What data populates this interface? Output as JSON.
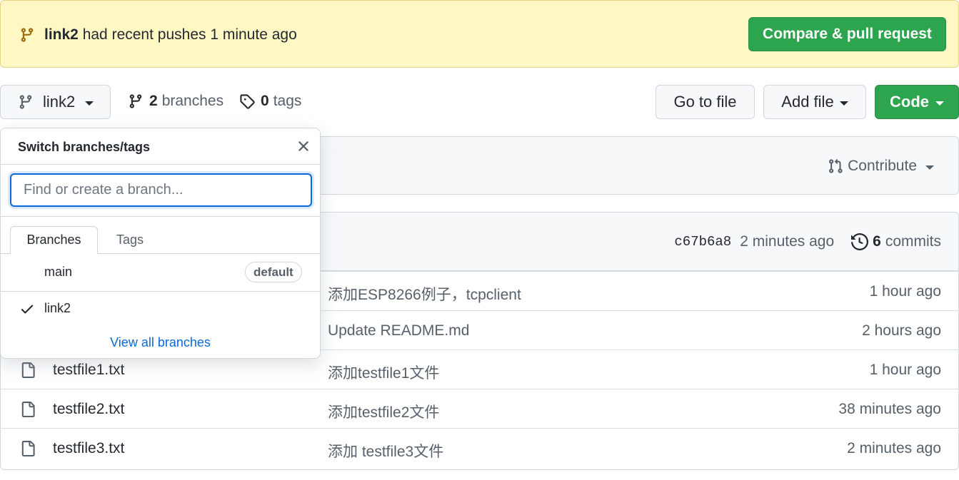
{
  "banner": {
    "branch": "link2",
    "message": "had recent pushes 1 minute ago",
    "button": "Compare & pull request"
  },
  "toolbar": {
    "current_branch": "link2",
    "branches_count": "2",
    "branches_label": "branches",
    "tags_count": "0",
    "tags_label": "tags",
    "go_to_file": "Go to file",
    "add_file": "Add file",
    "code": "Code"
  },
  "contribute": {
    "label": "Contribute"
  },
  "commit": {
    "sha": "c67b6a8",
    "time": "2 minutes ago",
    "count": "6",
    "count_label": "commits"
  },
  "files": [
    {
      "name": "",
      "message": "添加ESP8266例子，tcpclient",
      "age": "1 hour ago"
    },
    {
      "name": "",
      "message": "Update README.md",
      "age": "2 hours ago"
    },
    {
      "name": "testfile1.txt",
      "message": "添加testfile1文件",
      "age": "1 hour ago"
    },
    {
      "name": "testfile2.txt",
      "message": "添加testfile2文件",
      "age": "38 minutes ago"
    },
    {
      "name": "testfile3.txt",
      "message": "添加 testfile3文件",
      "age": "2 minutes ago"
    }
  ],
  "dropdown": {
    "title": "Switch branches/tags",
    "placeholder": "Find or create a branch...",
    "tab_branches": "Branches",
    "tab_tags": "Tags",
    "items": [
      {
        "label": "main",
        "badge": "default",
        "selected": false
      },
      {
        "label": "link2",
        "badge": "",
        "selected": true
      }
    ],
    "view_all": "View all branches"
  },
  "colors": {
    "green": "#2da44e",
    "banner_bg": "#fff8c5",
    "link": "#0969da",
    "border": "#d0d7de"
  }
}
